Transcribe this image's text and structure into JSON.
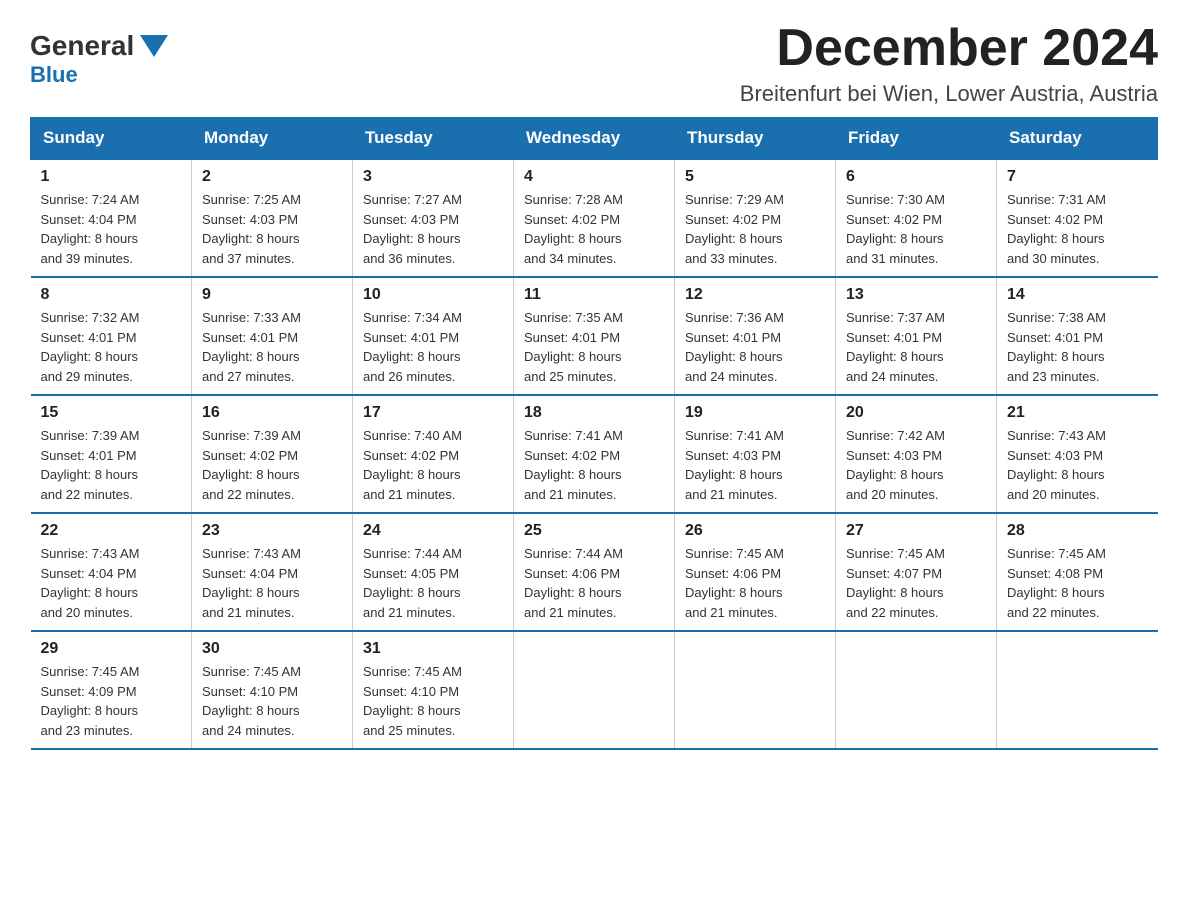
{
  "header": {
    "logo_general": "General",
    "logo_blue": "Blue",
    "month_year": "December 2024",
    "location": "Breitenfurt bei Wien, Lower Austria, Austria"
  },
  "weekdays": [
    "Sunday",
    "Monday",
    "Tuesday",
    "Wednesday",
    "Thursday",
    "Friday",
    "Saturday"
  ],
  "weeks": [
    [
      {
        "day": "1",
        "sunrise": "7:24 AM",
        "sunset": "4:04 PM",
        "daylight": "8 hours and 39 minutes."
      },
      {
        "day": "2",
        "sunrise": "7:25 AM",
        "sunset": "4:03 PM",
        "daylight": "8 hours and 37 minutes."
      },
      {
        "day": "3",
        "sunrise": "7:27 AM",
        "sunset": "4:03 PM",
        "daylight": "8 hours and 36 minutes."
      },
      {
        "day": "4",
        "sunrise": "7:28 AM",
        "sunset": "4:02 PM",
        "daylight": "8 hours and 34 minutes."
      },
      {
        "day": "5",
        "sunrise": "7:29 AM",
        "sunset": "4:02 PM",
        "daylight": "8 hours and 33 minutes."
      },
      {
        "day": "6",
        "sunrise": "7:30 AM",
        "sunset": "4:02 PM",
        "daylight": "8 hours and 31 minutes."
      },
      {
        "day": "7",
        "sunrise": "7:31 AM",
        "sunset": "4:02 PM",
        "daylight": "8 hours and 30 minutes."
      }
    ],
    [
      {
        "day": "8",
        "sunrise": "7:32 AM",
        "sunset": "4:01 PM",
        "daylight": "8 hours and 29 minutes."
      },
      {
        "day": "9",
        "sunrise": "7:33 AM",
        "sunset": "4:01 PM",
        "daylight": "8 hours and 27 minutes."
      },
      {
        "day": "10",
        "sunrise": "7:34 AM",
        "sunset": "4:01 PM",
        "daylight": "8 hours and 26 minutes."
      },
      {
        "day": "11",
        "sunrise": "7:35 AM",
        "sunset": "4:01 PM",
        "daylight": "8 hours and 25 minutes."
      },
      {
        "day": "12",
        "sunrise": "7:36 AM",
        "sunset": "4:01 PM",
        "daylight": "8 hours and 24 minutes."
      },
      {
        "day": "13",
        "sunrise": "7:37 AM",
        "sunset": "4:01 PM",
        "daylight": "8 hours and 24 minutes."
      },
      {
        "day": "14",
        "sunrise": "7:38 AM",
        "sunset": "4:01 PM",
        "daylight": "8 hours and 23 minutes."
      }
    ],
    [
      {
        "day": "15",
        "sunrise": "7:39 AM",
        "sunset": "4:01 PM",
        "daylight": "8 hours and 22 minutes."
      },
      {
        "day": "16",
        "sunrise": "7:39 AM",
        "sunset": "4:02 PM",
        "daylight": "8 hours and 22 minutes."
      },
      {
        "day": "17",
        "sunrise": "7:40 AM",
        "sunset": "4:02 PM",
        "daylight": "8 hours and 21 minutes."
      },
      {
        "day": "18",
        "sunrise": "7:41 AM",
        "sunset": "4:02 PM",
        "daylight": "8 hours and 21 minutes."
      },
      {
        "day": "19",
        "sunrise": "7:41 AM",
        "sunset": "4:03 PM",
        "daylight": "8 hours and 21 minutes."
      },
      {
        "day": "20",
        "sunrise": "7:42 AM",
        "sunset": "4:03 PM",
        "daylight": "8 hours and 20 minutes."
      },
      {
        "day": "21",
        "sunrise": "7:43 AM",
        "sunset": "4:03 PM",
        "daylight": "8 hours and 20 minutes."
      }
    ],
    [
      {
        "day": "22",
        "sunrise": "7:43 AM",
        "sunset": "4:04 PM",
        "daylight": "8 hours and 20 minutes."
      },
      {
        "day": "23",
        "sunrise": "7:43 AM",
        "sunset": "4:04 PM",
        "daylight": "8 hours and 21 minutes."
      },
      {
        "day": "24",
        "sunrise": "7:44 AM",
        "sunset": "4:05 PM",
        "daylight": "8 hours and 21 minutes."
      },
      {
        "day": "25",
        "sunrise": "7:44 AM",
        "sunset": "4:06 PM",
        "daylight": "8 hours and 21 minutes."
      },
      {
        "day": "26",
        "sunrise": "7:45 AM",
        "sunset": "4:06 PM",
        "daylight": "8 hours and 21 minutes."
      },
      {
        "day": "27",
        "sunrise": "7:45 AM",
        "sunset": "4:07 PM",
        "daylight": "8 hours and 22 minutes."
      },
      {
        "day": "28",
        "sunrise": "7:45 AM",
        "sunset": "4:08 PM",
        "daylight": "8 hours and 22 minutes."
      }
    ],
    [
      {
        "day": "29",
        "sunrise": "7:45 AM",
        "sunset": "4:09 PM",
        "daylight": "8 hours and 23 minutes."
      },
      {
        "day": "30",
        "sunrise": "7:45 AM",
        "sunset": "4:10 PM",
        "daylight": "8 hours and 24 minutes."
      },
      {
        "day": "31",
        "sunrise": "7:45 AM",
        "sunset": "4:10 PM",
        "daylight": "8 hours and 25 minutes."
      },
      null,
      null,
      null,
      null
    ]
  ],
  "labels": {
    "sunrise": "Sunrise:",
    "sunset": "Sunset:",
    "daylight": "Daylight:"
  }
}
